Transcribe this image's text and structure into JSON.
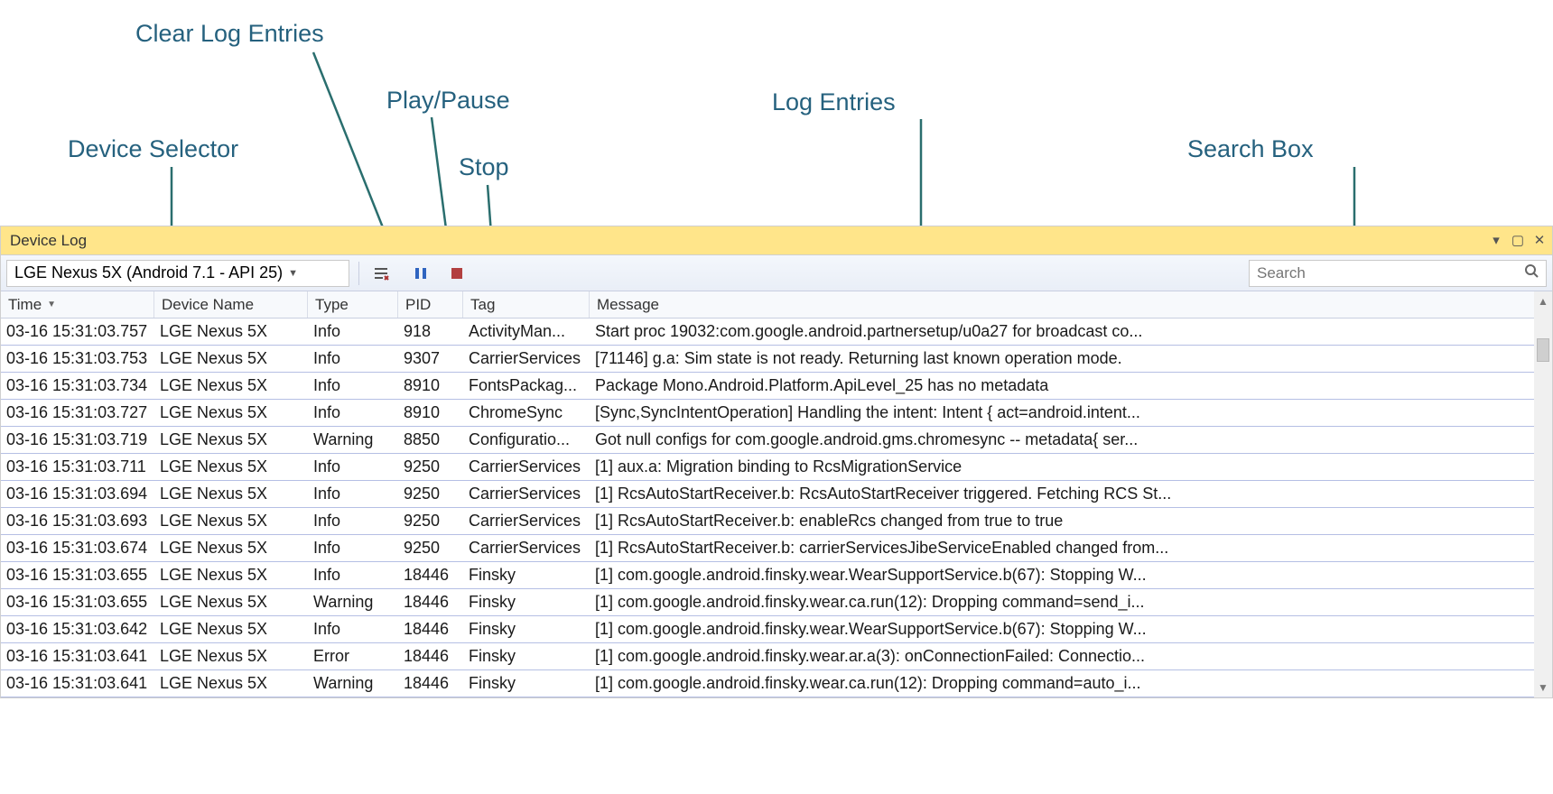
{
  "annotations": {
    "device_selector": "Device Selector",
    "clear_log": "Clear Log Entries",
    "play_pause": "Play/Pause",
    "stop": "Stop",
    "log_entries": "Log Entries",
    "search_box": "Search Box"
  },
  "titlebar": {
    "title": "Device Log"
  },
  "toolbar": {
    "device_selected": "LGE Nexus 5X (Android 7.1 - API 25)",
    "search_placeholder": "Search"
  },
  "columns": {
    "time": "Time",
    "device": "Device Name",
    "type": "Type",
    "pid": "PID",
    "tag": "Tag",
    "message": "Message"
  },
  "rows": [
    {
      "time": "03-16 15:31:03.757",
      "device": "LGE Nexus 5X",
      "type": "Info",
      "pid": "918",
      "tag": "ActivityMan...",
      "msg": "Start proc 19032:com.google.android.partnersetup/u0a27 for broadcast co..."
    },
    {
      "time": "03-16 15:31:03.753",
      "device": "LGE Nexus 5X",
      "type": "Info",
      "pid": "9307",
      "tag": "CarrierServices",
      "msg": "[71146] g.a: Sim state is not ready. Returning last known operation mode."
    },
    {
      "time": "03-16 15:31:03.734",
      "device": "LGE Nexus 5X",
      "type": "Info",
      "pid": "8910",
      "tag": "FontsPackag...",
      "msg": "Package Mono.Android.Platform.ApiLevel_25 has no metadata"
    },
    {
      "time": "03-16 15:31:03.727",
      "device": "LGE Nexus 5X",
      "type": "Info",
      "pid": "8910",
      "tag": "ChromeSync",
      "msg": "[Sync,SyncIntentOperation] Handling the intent: Intent { act=android.intent..."
    },
    {
      "time": "03-16 15:31:03.719",
      "device": "LGE Nexus 5X",
      "type": "Warning",
      "pid": "8850",
      "tag": "Configuratio...",
      "msg": "Got null configs for com.google.android.gms.chromesync -- metadata{ ser..."
    },
    {
      "time": "03-16 15:31:03.711",
      "device": "LGE Nexus 5X",
      "type": "Info",
      "pid": "9250",
      "tag": "CarrierServices",
      "msg": "[1] aux.a: Migration binding to RcsMigrationService"
    },
    {
      "time": "03-16 15:31:03.694",
      "device": "LGE Nexus 5X",
      "type": "Info",
      "pid": "9250",
      "tag": "CarrierServices",
      "msg": "[1] RcsAutoStartReceiver.b: RcsAutoStartReceiver triggered. Fetching RCS St..."
    },
    {
      "time": "03-16 15:31:03.693",
      "device": "LGE Nexus 5X",
      "type": "Info",
      "pid": "9250",
      "tag": "CarrierServices",
      "msg": "[1] RcsAutoStartReceiver.b: enableRcs changed from true to true"
    },
    {
      "time": "03-16 15:31:03.674",
      "device": "LGE Nexus 5X",
      "type": "Info",
      "pid": "9250",
      "tag": "CarrierServices",
      "msg": "[1] RcsAutoStartReceiver.b: carrierServicesJibeServiceEnabled changed from..."
    },
    {
      "time": "03-16 15:31:03.655",
      "device": "LGE Nexus 5X",
      "type": "Info",
      "pid": "18446",
      "tag": "Finsky",
      "msg": "[1] com.google.android.finsky.wear.WearSupportService.b(67): Stopping W..."
    },
    {
      "time": "03-16 15:31:03.655",
      "device": "LGE Nexus 5X",
      "type": "Warning",
      "pid": "18446",
      "tag": "Finsky",
      "msg": "[1] com.google.android.finsky.wear.ca.run(12): Dropping command=send_i..."
    },
    {
      "time": "03-16 15:31:03.642",
      "device": "LGE Nexus 5X",
      "type": "Info",
      "pid": "18446",
      "tag": "Finsky",
      "msg": "[1] com.google.android.finsky.wear.WearSupportService.b(67): Stopping W..."
    },
    {
      "time": "03-16 15:31:03.641",
      "device": "LGE Nexus 5X",
      "type": "Error",
      "pid": "18446",
      "tag": "Finsky",
      "msg": "[1] com.google.android.finsky.wear.ar.a(3): onConnectionFailed: Connectio..."
    },
    {
      "time": "03-16 15:31:03.641",
      "device": "LGE Nexus 5X",
      "type": "Warning",
      "pid": "18446",
      "tag": "Finsky",
      "msg": "[1] com.google.android.finsky.wear.ca.run(12): Dropping command=auto_i..."
    }
  ]
}
